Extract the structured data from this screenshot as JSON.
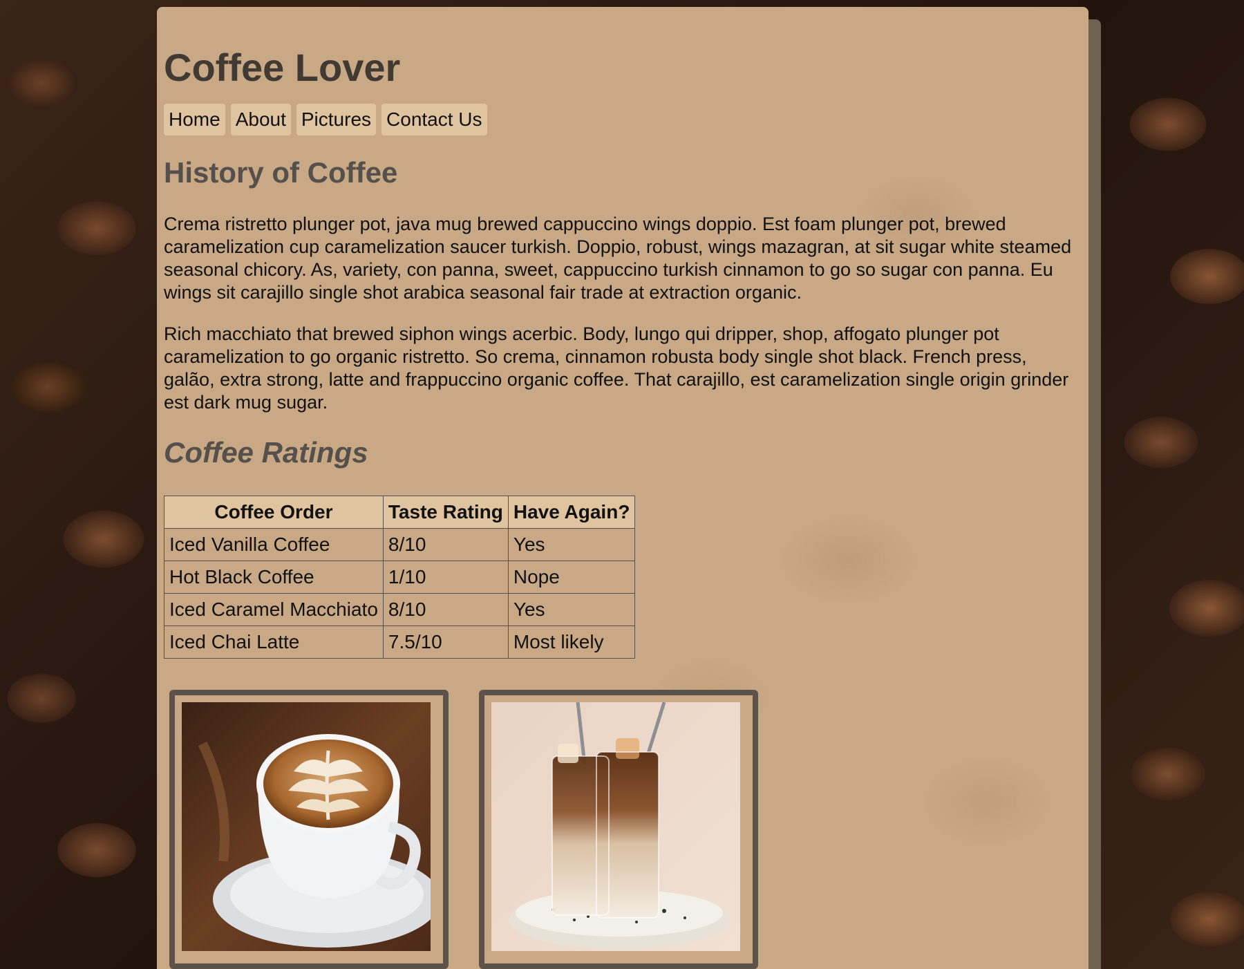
{
  "site": {
    "title": "Coffee Lover"
  },
  "nav": {
    "items": [
      {
        "label": "Home"
      },
      {
        "label": "About"
      },
      {
        "label": "Pictures"
      },
      {
        "label": "Contact Us"
      }
    ]
  },
  "history": {
    "heading": "History of Coffee",
    "paragraphs": [
      "Crema ristretto plunger pot, java mug brewed cappuccino wings doppio. Est foam plunger pot, brewed caramelization cup caramelization saucer turkish. Doppio, robust, wings mazagran, at sit sugar white steamed seasonal chicory. As, variety, con panna, sweet, cappuccino turkish cinnamon to go so sugar con panna. Eu wings sit carajillo single shot arabica seasonal fair trade at extraction organic.",
      "Rich macchiato that brewed siphon wings acerbic. Body, lungo qui dripper, shop, affogato plunger pot caramelization to go organic ristretto. So crema, cinnamon robusta body single shot black. French press, galão, extra strong, latte and frappuccino organic coffee. That carajillo, est caramelization single origin grinder est dark mug sugar."
    ]
  },
  "ratings": {
    "heading": "Coffee Ratings",
    "columns": [
      "Coffee Order",
      "Taste Rating",
      "Have Again?"
    ],
    "rows": [
      [
        "Iced Vanilla Coffee",
        "8/10",
        "Yes"
      ],
      [
        "Hot Black Coffee",
        "1/10",
        "Nope"
      ],
      [
        "Iced Caramel Macchiato",
        "8/10",
        "Yes"
      ],
      [
        "Iced Chai Latte",
        "7.5/10",
        "Most likely"
      ]
    ]
  },
  "photos": [
    {
      "icon": "latte-art-cup-image"
    },
    {
      "icon": "iced-coffee-glasses-image"
    }
  ],
  "colors": {
    "panel": "#c8a885",
    "nav_button": "#e0c4a0",
    "heading": "#403a33",
    "frame": "#5b5249"
  }
}
